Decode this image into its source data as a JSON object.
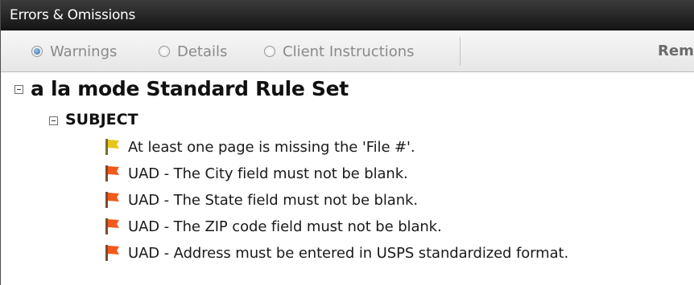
{
  "window": {
    "title": "Errors & Omissions"
  },
  "toolbar": {
    "radios": [
      {
        "label": "Warnings",
        "checked": true
      },
      {
        "label": "Details",
        "checked": false
      },
      {
        "label": "Client Instructions",
        "checked": false
      }
    ],
    "remove_label": "Rem"
  },
  "tree": {
    "rule_set": "a la mode Standard Rule Set",
    "category": "SUBJECT",
    "messages": [
      {
        "text": "At least one page is missing the 'File #'.",
        "severity": "yellow-flag-icon",
        "color": "#e8c619"
      },
      {
        "text": "UAD - The City field must not be blank.",
        "severity": "orange-flag-icon",
        "color": "#f2591a"
      },
      {
        "text": "UAD - The State field must not be blank.",
        "severity": "orange-flag-icon",
        "color": "#f2591a"
      },
      {
        "text": "UAD - The ZIP code field must not be blank.",
        "severity": "orange-flag-icon",
        "color": "#f2591a"
      },
      {
        "text": "UAD - Address must be entered in USPS standardized format.",
        "severity": "orange-flag-icon",
        "color": "#f2591a"
      }
    ]
  }
}
